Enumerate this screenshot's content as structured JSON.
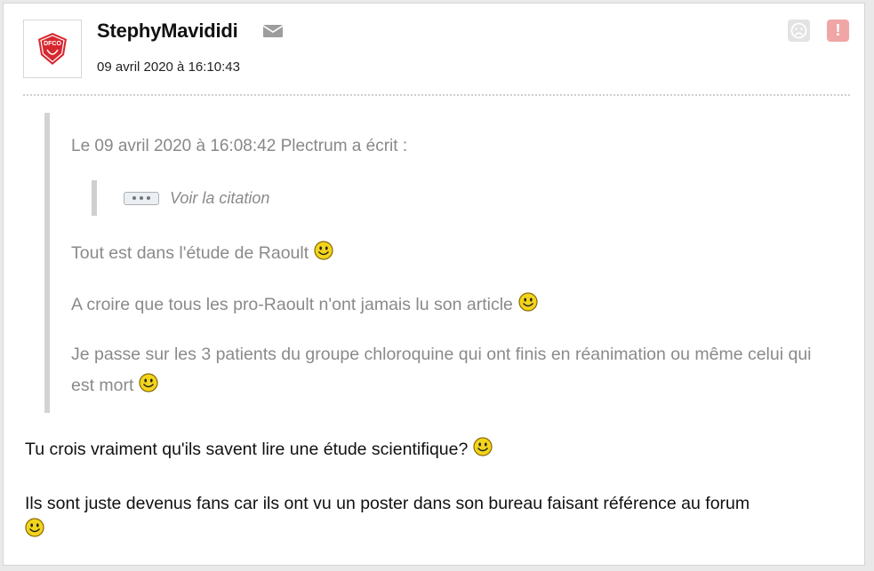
{
  "post": {
    "author": "StephyMavididi",
    "date": "09 avril 2020 à 16:10:43",
    "avatar_label": "DFCO",
    "icons": [
      "envelope-icon",
      "sad-face-icon",
      "alert-icon"
    ],
    "colors": {
      "alert": "#f0a6a6",
      "quote_text": "#8a8a8a",
      "body_text": "#111111"
    }
  },
  "quote": {
    "header": "Le 09 avril 2020 à 16:08:42 Plectrum a écrit :",
    "nested_label": "Voir la citation",
    "lines": [
      "Tout est dans l'étude de Raoult",
      "A croire que tous les pro-Raoult n'ont jamais lu son article",
      "Je passe sur les 3 patients du groupe chloroquine qui ont finis en réanimation ou même celui qui est mort"
    ]
  },
  "reply": {
    "lines": [
      "Tu crois vraiment qu'ils savent lire une étude scientifique?",
      "Ils sont juste devenus fans car ils ont vu un poster dans son bureau faisant référence au forum"
    ]
  }
}
